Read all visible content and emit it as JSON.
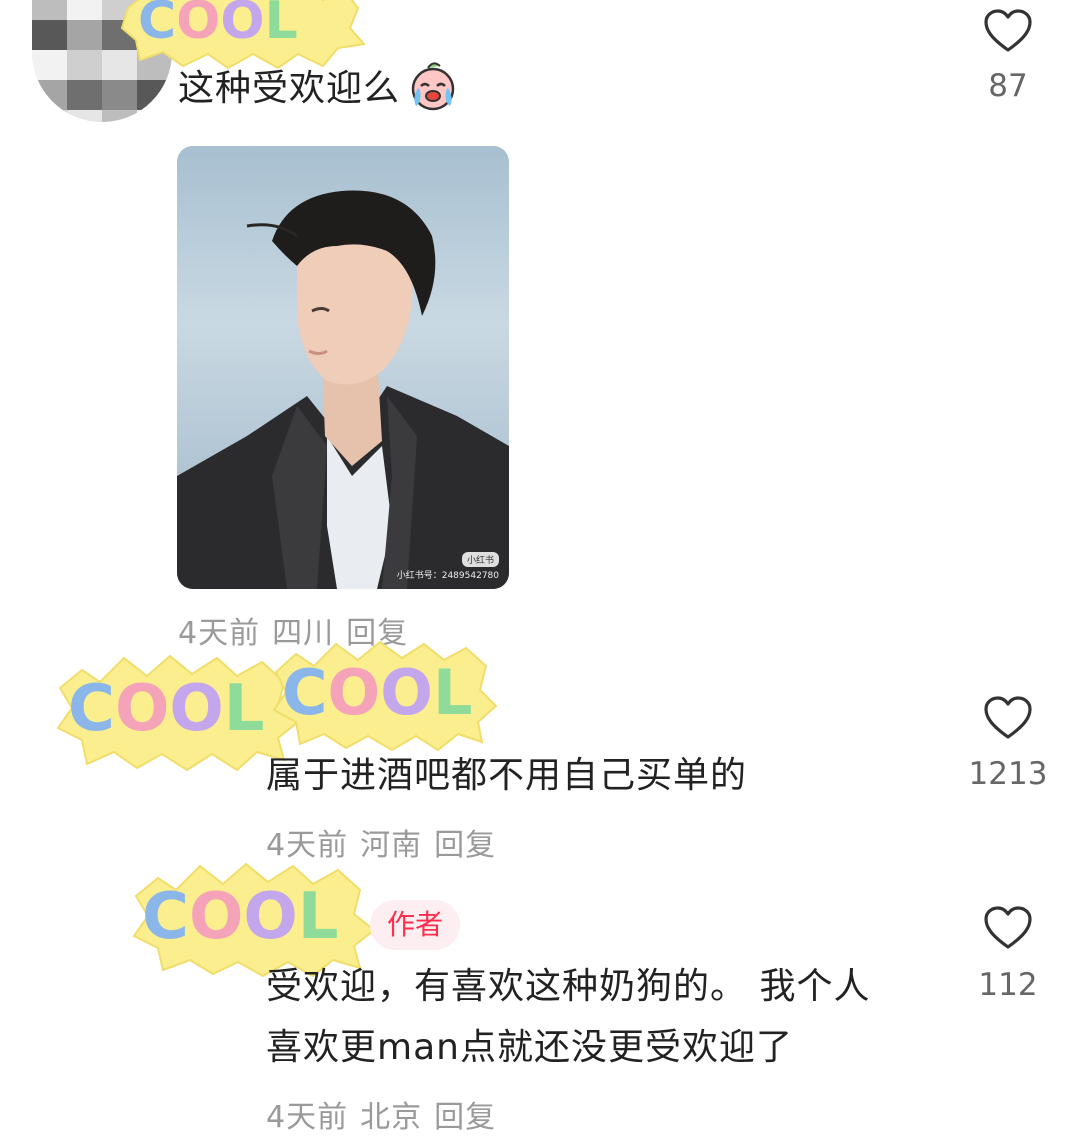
{
  "comments": [
    {
      "text": "这种受欢迎么",
      "emoji": "crying-face-emoji",
      "meta": {
        "time": "4天前",
        "location": "四川",
        "reply": "回复"
      },
      "likes": "87",
      "image": {
        "watermark_logo": "小红书",
        "watermark_text": "小红书号：2489542780"
      }
    },
    {
      "text": "属于进酒吧都不用自己买单的",
      "meta": {
        "time": "4天前",
        "location": "河南",
        "reply": "回复"
      },
      "likes": "1213"
    },
    {
      "author_badge": "作者",
      "text_line1": "受欢迎，有喜欢这种奶狗的。 我个人",
      "text_line2": "喜欢更man点就还没更受欢迎了",
      "meta": {
        "time": "4天前",
        "location": "北京",
        "reply": "回复"
      },
      "likes": "112"
    }
  ],
  "sticker_text": "COOL",
  "colors": {
    "accent": "#ff2e4d",
    "meta": "#9a9a9a"
  }
}
